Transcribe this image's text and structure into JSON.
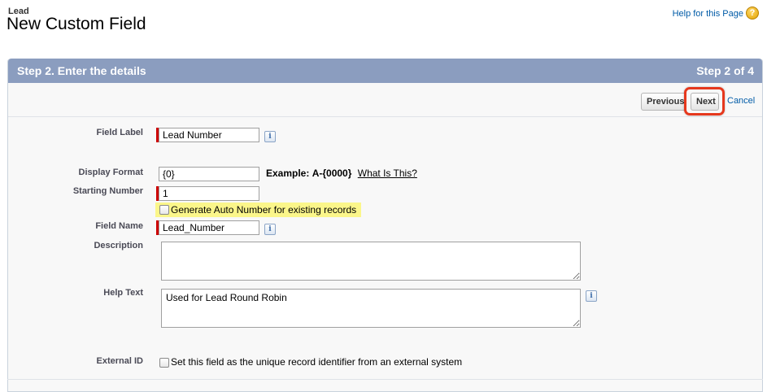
{
  "header": {
    "breadcrumb": "Lead",
    "title": "New Custom Field",
    "help_link": "Help for this Page",
    "help_icon": "?"
  },
  "step": {
    "left_title": "Step 2. Enter the details",
    "right_title": "Step 2 of 4"
  },
  "buttons": {
    "previous": "Previous",
    "next": "Next",
    "cancel": "Cancel"
  },
  "form": {
    "field_label": {
      "label": "Field Label",
      "value": "Lead Number"
    },
    "display_format": {
      "label": "Display Format",
      "value": "{0}",
      "example_prefix": "Example:",
      "example_value": "A-{0000}",
      "what_is_this": "What Is This?"
    },
    "starting_number": {
      "label": "Starting Number",
      "value": "1"
    },
    "generate_auto_number": {
      "label": "Generate Auto Number for existing records",
      "checked": false
    },
    "field_name": {
      "label": "Field Name",
      "value": "Lead_Number"
    },
    "description": {
      "label": "Description",
      "value": ""
    },
    "help_text": {
      "label": "Help Text",
      "value": "Used for Lead Round Robin"
    },
    "external_id": {
      "label": "External ID",
      "checkbox_text": "Set this field as the unique record identifier from an external system",
      "checked": false
    }
  },
  "colors": {
    "header_bar": "#8b9dbf",
    "link": "#015ba7",
    "required": "#cc0000",
    "highlight": "#fbf68a",
    "next_outline": "#e6381d"
  },
  "icons": {
    "info": "i"
  }
}
